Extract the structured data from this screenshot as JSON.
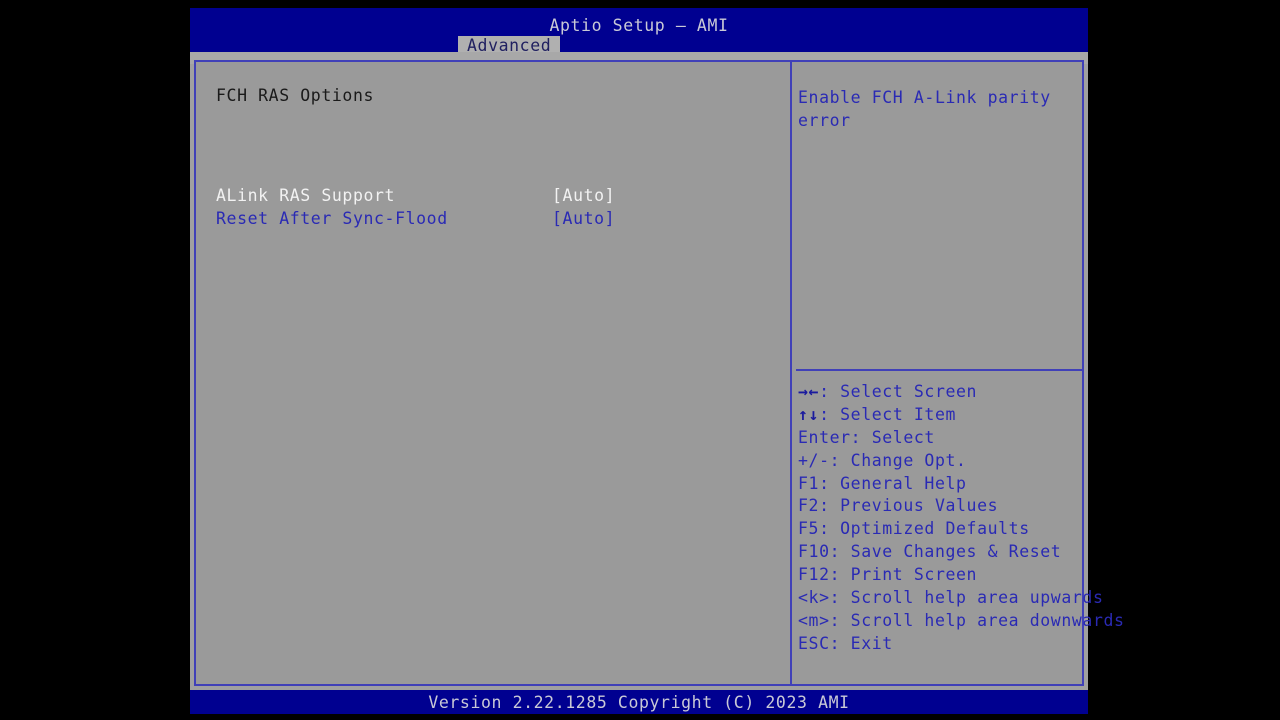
{
  "window": {
    "title": "Aptio Setup – AMI",
    "colors": {
      "header_blue": "#000090",
      "panel_gray": "#9a9a9a",
      "border_blue": "#4040b8",
      "selected_text": "#f2f2f2",
      "normal_text": "#2a2ab4",
      "heading_text": "#1a1a1a",
      "footer_text": "#c9c9d6"
    }
  },
  "tabs": [
    {
      "label": "Advanced",
      "active": true
    }
  ],
  "main": {
    "section_heading": "FCH RAS Options",
    "options": [
      {
        "label": "ALink RAS Support",
        "value": "[Auto]",
        "selected": true
      },
      {
        "label": "Reset After Sync-Flood",
        "value": "[Auto]",
        "selected": false
      }
    ]
  },
  "help": {
    "description": "Enable FCH A-Link parity error",
    "keys": [
      {
        "glyph": "→←",
        "text": ": Select Screen"
      },
      {
        "glyph": "↑↓",
        "text": ": Select Item"
      },
      {
        "glyph": "",
        "text": "Enter: Select"
      },
      {
        "glyph": "",
        "text": "+/-: Change Opt."
      },
      {
        "glyph": "",
        "text": "F1: General Help"
      },
      {
        "glyph": "",
        "text": "F2: Previous Values"
      },
      {
        "glyph": "",
        "text": "F5: Optimized Defaults"
      },
      {
        "glyph": "",
        "text": "F10: Save Changes & Reset"
      },
      {
        "glyph": "",
        "text": "F12: Print Screen"
      },
      {
        "glyph": "",
        "text": "<k>: Scroll help area upwards"
      },
      {
        "glyph": "",
        "text": "<m>: Scroll help area downwards"
      },
      {
        "glyph": "",
        "text": "ESC: Exit"
      }
    ]
  },
  "footer": {
    "version_text": "Version 2.22.1285 Copyright (C) 2023 AMI"
  }
}
